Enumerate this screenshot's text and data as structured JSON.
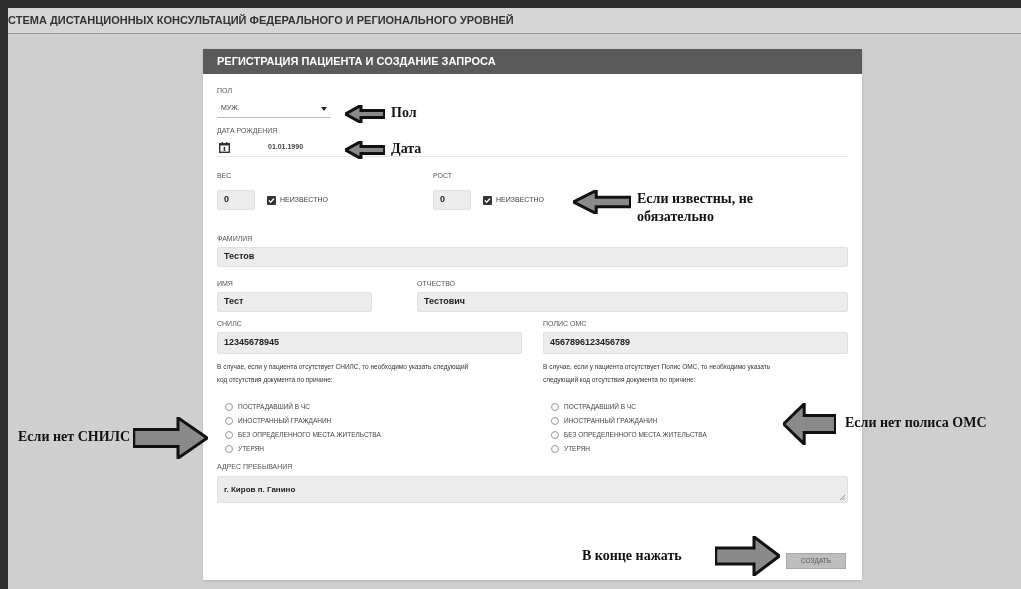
{
  "app_title": "СТЕМА ДИСТАНЦИОННЫХ КОНСУЛЬТАЦИЙ ФЕДЕРАЛЬНОГО И РЕГИОНАЛЬНОГО УРОВНЕЙ",
  "form": {
    "title": "РЕГИСТРАЦИЯ ПАЦИЕНТА И СОЗДАНИЕ ЗАПРОСА",
    "sex": {
      "label": "ПОЛ",
      "value": "МУЖ."
    },
    "birth_date": {
      "label": "ДАТА РОЖДЕНИЯ",
      "value": "01.01.1990"
    },
    "weight": {
      "label": "ВЕС",
      "value": "0",
      "unknown_label": "НЕИЗВЕСТНО",
      "unknown_checked": true
    },
    "height": {
      "label": "РОСТ",
      "value": "0",
      "unknown_label": "НЕИЗВЕСТНО",
      "unknown_checked": true
    },
    "surname": {
      "label": "ФАМИЛИЯ",
      "value": "Тестов"
    },
    "name": {
      "label": "ИМЯ",
      "value": "Тест"
    },
    "patronymic": {
      "label": "ОТЧЕСТВО",
      "value": "Тестович"
    },
    "documents": [
      {
        "label": "СНИЛС",
        "value": "12345678945",
        "note": "В случае, если у пациента отсутствует СНИЛС, то необходимо указать следующий код отсутствия документа по причине:",
        "options": [
          {
            "label": "ПОСТРАДАВШИЙ В ЧС",
            "selected": false
          },
          {
            "label": "ИНОСТРАННЫЙ ГРАЖДАНИН",
            "selected": false
          },
          {
            "label": "БЕЗ ОПРЕДЕЛЕННОГО МЕСТА ЖИТЕЛЬСТВА",
            "selected": false
          },
          {
            "label": "УТЕРЯН",
            "selected": false
          }
        ]
      },
      {
        "label": "ПОЛИС ОМС",
        "value": "4567896123456789",
        "note": "В случае, если у пациента отсутствует Полис ОМС, то необходимо указать следующий код отсутствия документа по причине:",
        "options": [
          {
            "label": "ПОСТРАДАВШИЙ В ЧС",
            "selected": false
          },
          {
            "label": "ИНОСТРАННЫЙ ГРАЖДАНИН",
            "selected": false
          },
          {
            "label": "БЕЗ ОПРЕДЕЛЕННОГО МЕСТА ЖИТЕЛЬСТВА",
            "selected": false
          },
          {
            "label": "УТЕРЯН",
            "selected": false
          }
        ]
      }
    ],
    "address": {
      "label": "АДРЕС ПРЕБЫВАНИЯ",
      "value": "г. Киров п. Ганино"
    },
    "submit": "СОЗДАТЬ"
  },
  "annotations": [
    {
      "text": "Пол",
      "kind": "left-arrow"
    },
    {
      "text": "Дата",
      "kind": "left-arrow"
    },
    {
      "text": "Если известны, не обязательно",
      "kind": "left-arrow"
    },
    {
      "text": "Если нет СНИЛС",
      "kind": "right-arrow"
    },
    {
      "text": "Если нет полиса ОМС",
      "kind": "left-arrow"
    },
    {
      "text": "В конце нажать",
      "kind": "right-arrow"
    }
  ]
}
